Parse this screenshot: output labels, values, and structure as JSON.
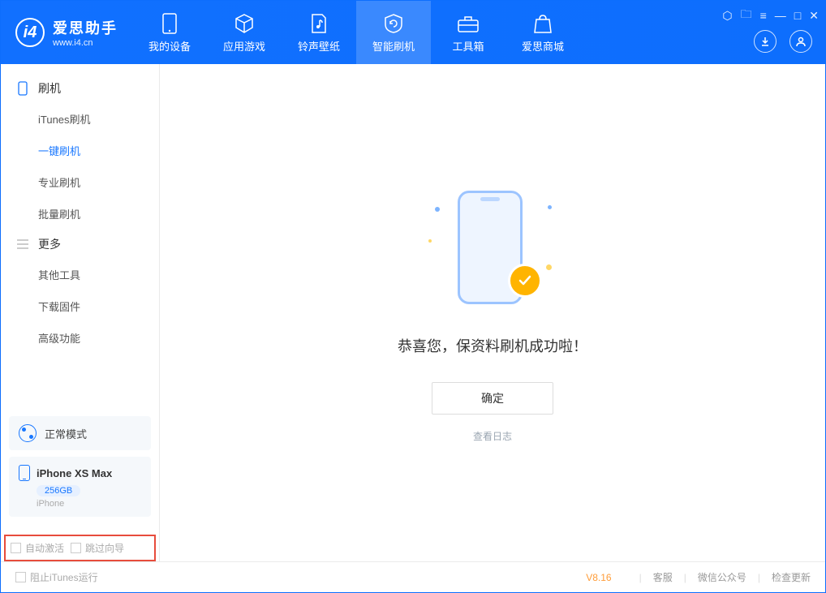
{
  "app": {
    "name_cn": "爱思助手",
    "name_en": "www.i4.cn"
  },
  "tabs": [
    {
      "label": "我的设备"
    },
    {
      "label": "应用游戏"
    },
    {
      "label": "铃声壁纸"
    },
    {
      "label": "智能刷机"
    },
    {
      "label": "工具箱"
    },
    {
      "label": "爱思商城"
    }
  ],
  "active_tab_index": 3,
  "sidebar": {
    "groups": [
      {
        "title": "刷机",
        "items": [
          {
            "label": "iTunes刷机"
          },
          {
            "label": "一键刷机"
          },
          {
            "label": "专业刷机"
          },
          {
            "label": "批量刷机"
          }
        ],
        "active_index": 1
      },
      {
        "title": "更多",
        "items": [
          {
            "label": "其他工具"
          },
          {
            "label": "下载固件"
          },
          {
            "label": "高级功能"
          }
        ]
      }
    ],
    "mode": "正常模式",
    "device": {
      "name": "iPhone XS Max",
      "storage": "256GB",
      "type": "iPhone"
    },
    "options": {
      "auto_activate": "自动激活",
      "skip_guide": "跳过向导"
    }
  },
  "main": {
    "message": "恭喜您，保资料刷机成功啦！",
    "confirm": "确定",
    "view_log": "查看日志"
  },
  "footer": {
    "block_itunes": "阻止iTunes运行",
    "version": "V8.16",
    "links": [
      "客服",
      "微信公众号",
      "检查更新"
    ]
  }
}
